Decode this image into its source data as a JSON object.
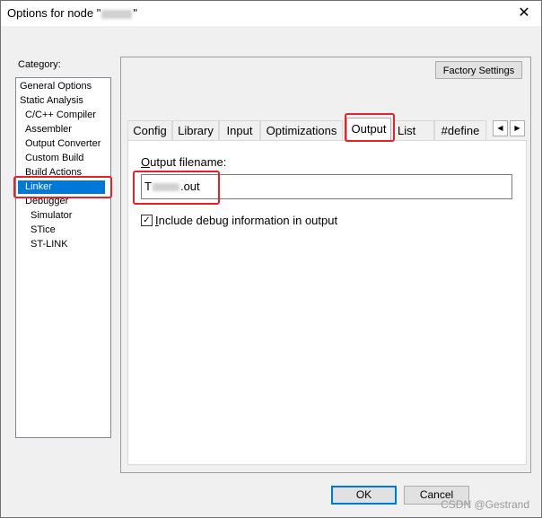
{
  "window": {
    "title_prefix": "Options for node \"",
    "title_suffix": "\"",
    "close_glyph": "✕"
  },
  "category": {
    "label": "Category:",
    "items": [
      {
        "label": "General Options"
      },
      {
        "label": "Static Analysis"
      },
      {
        "label": "C/C++ Compiler"
      },
      {
        "label": "Assembler"
      },
      {
        "label": "Output Converter"
      },
      {
        "label": "Custom Build"
      },
      {
        "label": "Build Actions"
      },
      {
        "label": "Linker"
      },
      {
        "label": "Debugger"
      },
      {
        "label": "Simulator"
      },
      {
        "label": "STice"
      },
      {
        "label": "ST-LINK"
      }
    ],
    "selected": "Linker"
  },
  "factory_settings_label": "Factory Settings",
  "tabs": [
    {
      "label": "Config"
    },
    {
      "label": "Library"
    },
    {
      "label": "Input"
    },
    {
      "label": "Optimizations"
    },
    {
      "label": "Output"
    },
    {
      "label": "List"
    },
    {
      "label": "#define"
    }
  ],
  "active_tab": "Output",
  "scroll": {
    "left_glyph": "◀",
    "right_glyph": "▶"
  },
  "output": {
    "label_underlined": "O",
    "label_rest": "utput filename:",
    "filename_prefix": "T",
    "filename_suffix": ".out",
    "include_debug_checked": true,
    "include_debug_underlined": "I",
    "include_debug_rest": "nclude debug information in output"
  },
  "buttons": {
    "ok": "OK",
    "cancel": "Cancel"
  },
  "watermark": "CSDN @Gestrand",
  "colors": {
    "highlight_red": "#e8202a",
    "selection_blue": "#0078d7"
  }
}
